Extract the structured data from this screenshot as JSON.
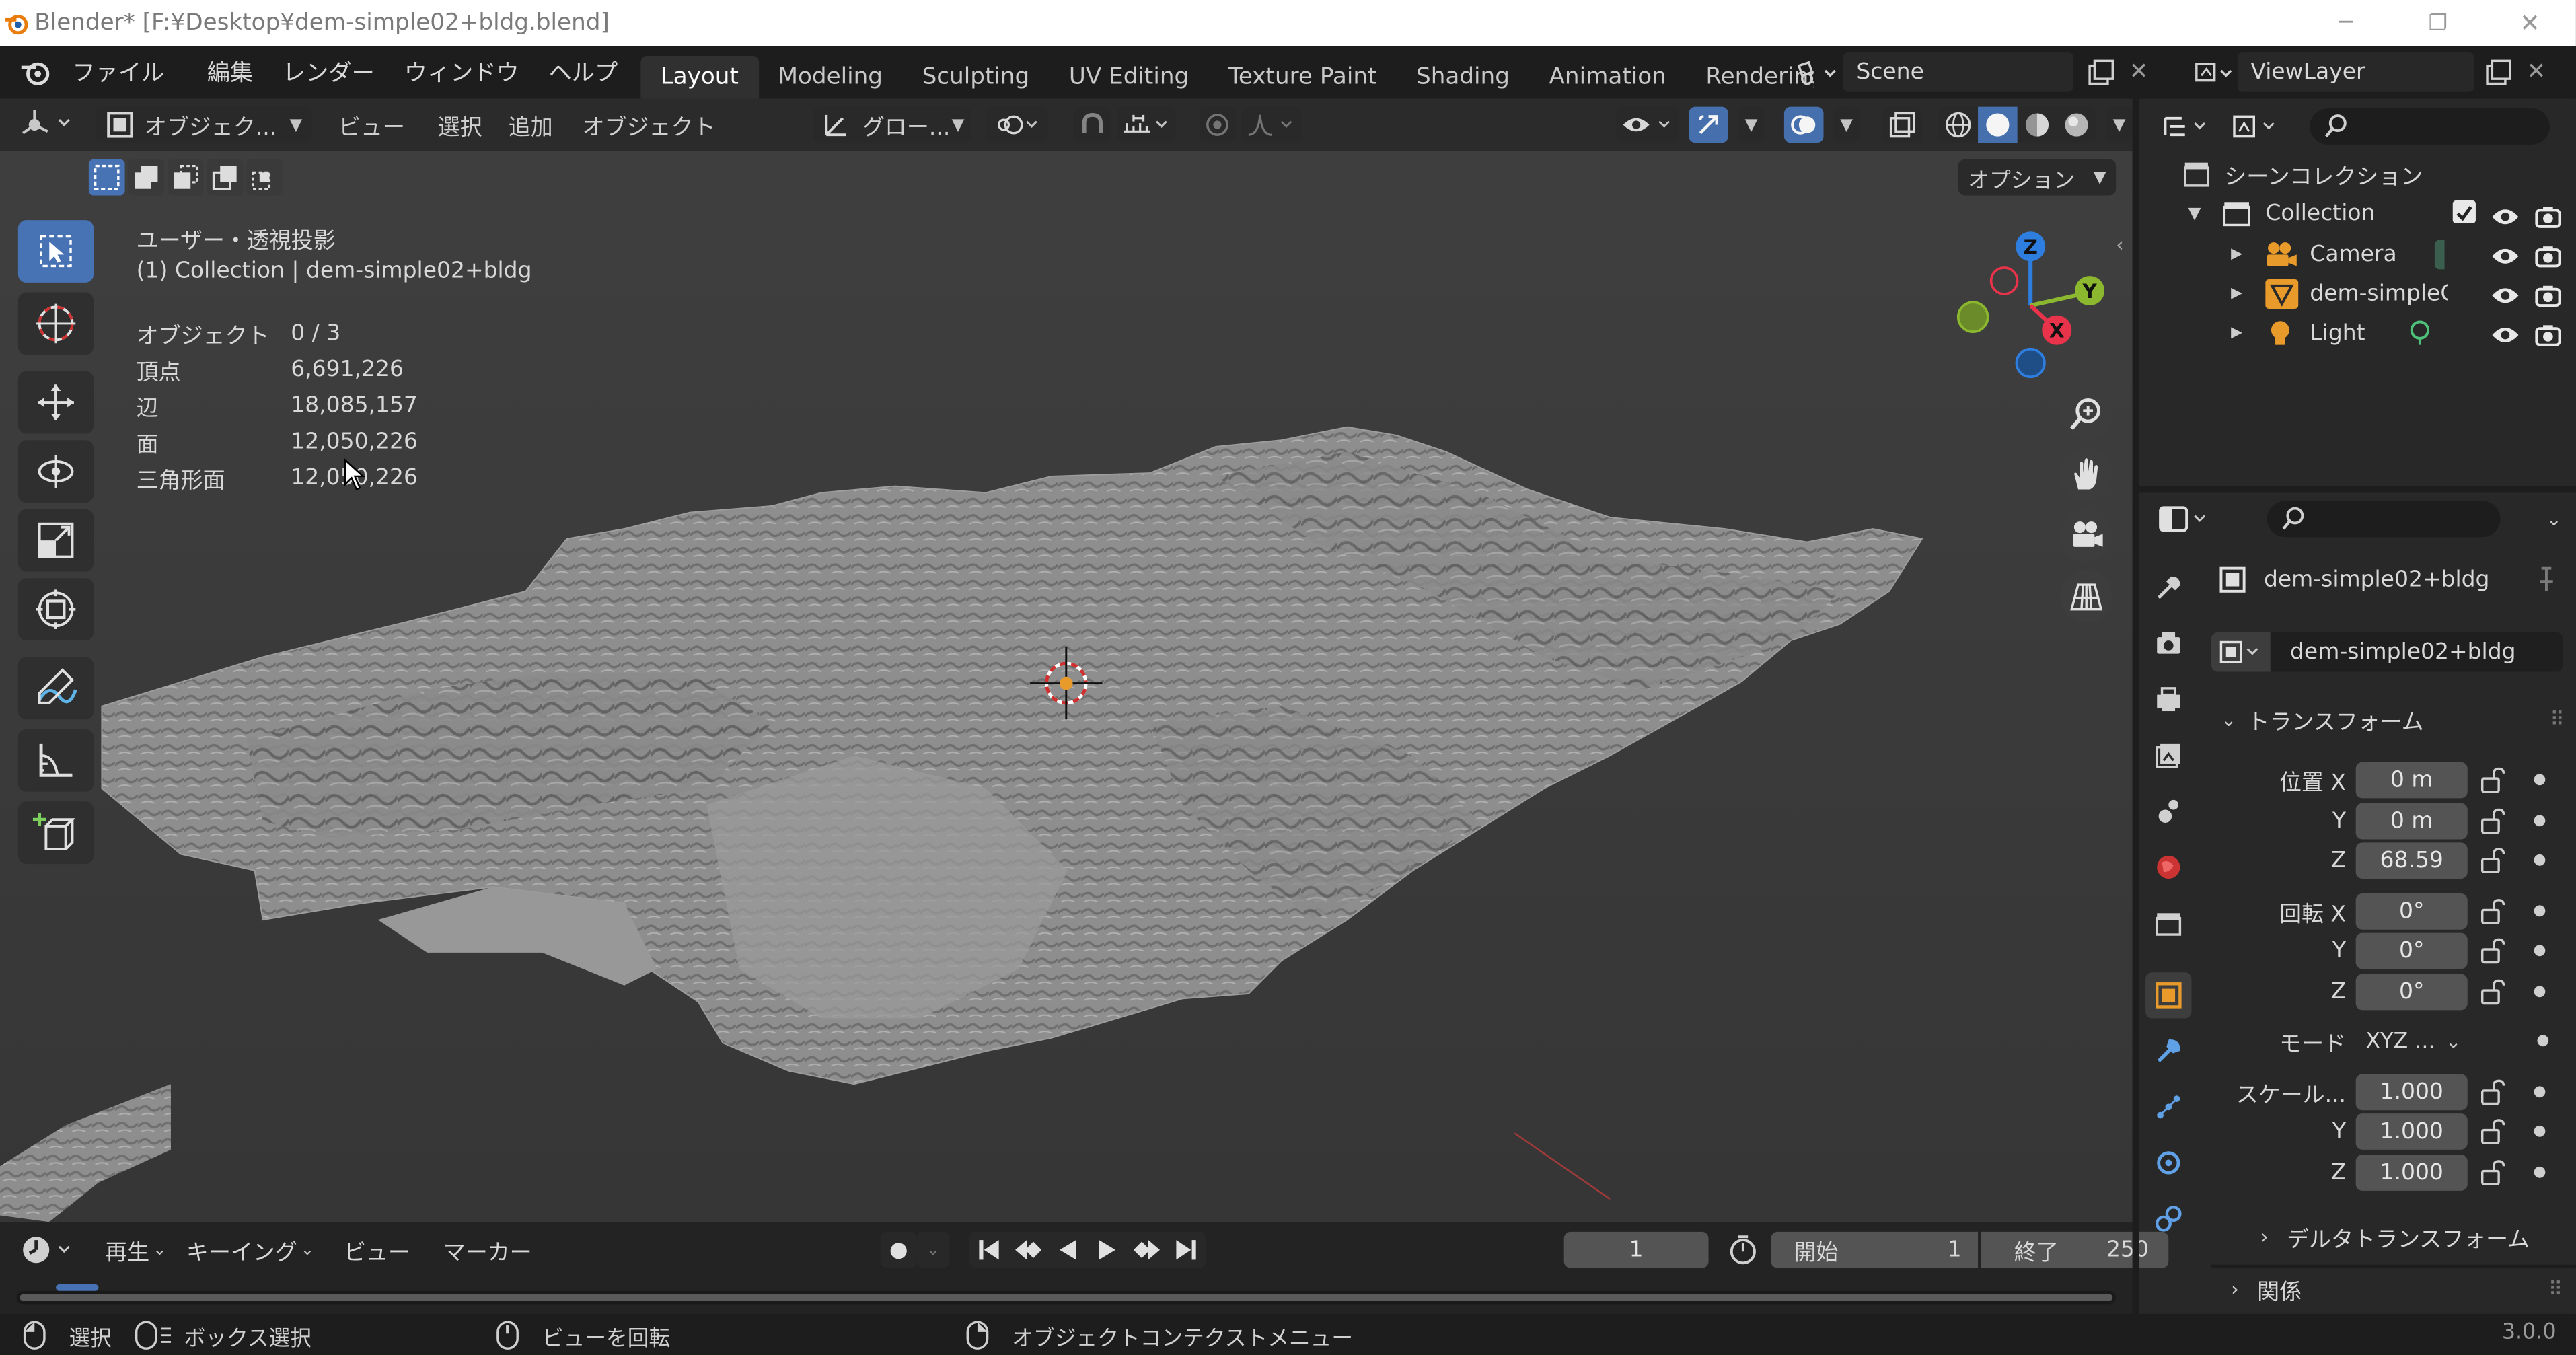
{
  "window": {
    "title": "Blender* [F:¥Desktop¥dem-simple02+bldg.blend]"
  },
  "menu": {
    "items": [
      "ファイル",
      "編集",
      "レンダー",
      "ウィンドウ",
      "ヘルプ"
    ]
  },
  "workspaces": [
    "Layout",
    "Modeling",
    "Sculpting",
    "UV Editing",
    "Texture Paint",
    "Shading",
    "Animation",
    "Renderinç"
  ],
  "scene": {
    "name": "Scene"
  },
  "viewlayer": {
    "name": "ViewLayer"
  },
  "viewport_header": {
    "mode": "オブジェク...",
    "menus": [
      "ビュー",
      "選択",
      "追加",
      "オブジェクト"
    ],
    "orientation": "グロー...",
    "options": "オプション"
  },
  "overlay_info": {
    "view_name": "ユーザー・透視投影",
    "collection_line": "(1) Collection | dem-simple02+bldg",
    "stats": [
      {
        "label": "オブジェクト",
        "value": "0 / 3"
      },
      {
        "label": "頂点",
        "value": "6,691,226"
      },
      {
        "label": "辺",
        "value": "18,085,157"
      },
      {
        "label": "面",
        "value": "12,050,226"
      },
      {
        "label": "三角形面",
        "value": "12,050,226"
      }
    ]
  },
  "gizmo": {
    "z": "Z",
    "y": "Y",
    "x": "X"
  },
  "outliner": {
    "root": "シーンコレクション",
    "collection": "Collection",
    "items": [
      {
        "name": "Camera"
      },
      {
        "name": "dem-simpleC"
      },
      {
        "name": "Light"
      }
    ]
  },
  "properties": {
    "object_name": "dem-simple02+bldg",
    "data_name": "dem-simple02+bldg",
    "transform_header": "トランスフォーム",
    "location_label": "位置 X",
    "location": [
      "0 m",
      "0 m",
      "68.59"
    ],
    "rotation_label": "回転 X",
    "rotation": [
      "0°",
      "0°",
      "0°"
    ],
    "mode_label": "モード",
    "mode_value": "XYZ ...",
    "scale_label": "スケール...",
    "scale": [
      "1.000",
      "1.000",
      "1.000"
    ],
    "axis_y": "Y",
    "axis_z": "Z",
    "delta_transform": "デルタトランスフォーム",
    "relations": "関係"
  },
  "timeline": {
    "menus": [
      "再生",
      "キーイング",
      "ビュー",
      "マーカー"
    ],
    "current_frame": "1",
    "start_label": "開始",
    "start": "1",
    "end_label": "終了",
    "end": "250"
  },
  "statusbar": {
    "items": [
      "選択",
      "ボックス選択",
      "ビューを回転",
      "オブジェクトコンテクストメニュー"
    ],
    "version": "3.0.0"
  },
  "colors": {
    "accent": "#4772b3",
    "axis_x": "#e8334a",
    "axis_y": "#8bb82f",
    "axis_z": "#2e7ee0"
  }
}
